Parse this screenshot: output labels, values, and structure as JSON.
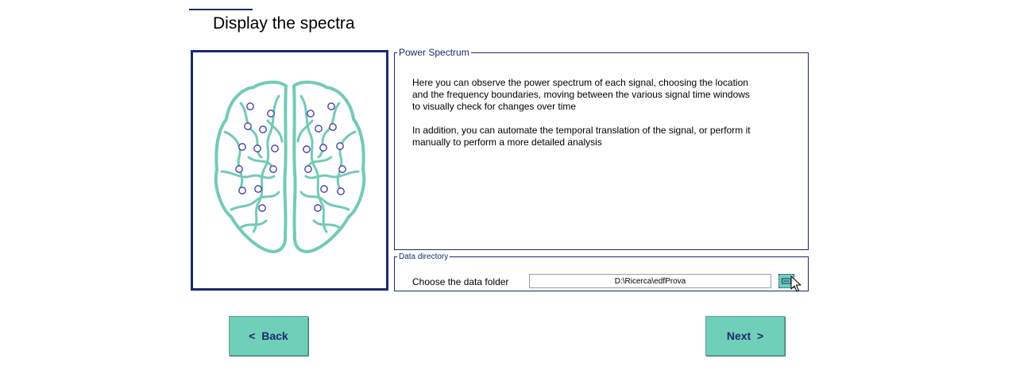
{
  "page": {
    "title": "Display the spectra"
  },
  "power_spectrum": {
    "legend": "Power Spectrum",
    "paragraph1": "Here you can observe the power spectrum of each signal, choosing the location and the frequency boundaries, moving between the various signal time windows to visually check for changes over time",
    "paragraph2": "In addition, you can automate the temporal translation of the signal, or perform it manually to perform a more detailed analysis"
  },
  "data_directory": {
    "legend": "Data directory",
    "label": "Choose the data folder",
    "path": "D:\\Ricerca\\edfProva",
    "browse_icon": "folder-browse-icon"
  },
  "nav": {
    "back_label": "<  Back",
    "next_label": "Next  >"
  },
  "colors": {
    "accent": "#6fcfb8",
    "navy": "#1b2a6b",
    "brain": "#72cbb6",
    "electrode": "#3a36a8"
  }
}
